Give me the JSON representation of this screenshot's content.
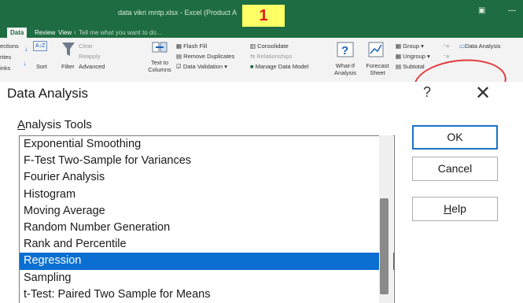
{
  "window": {
    "title": "data vikri mntp.xlsx - Excel (Product A",
    "annotation_badge": "1",
    "minimize_label": "—",
    "restore_label": "▣"
  },
  "tabs": [
    {
      "label": "Data",
      "active": true
    },
    {
      "label": "Review",
      "active": false
    },
    {
      "label": "View",
      "active": false
    }
  ],
  "tell_me": "♀ Tell me what you want to do...",
  "ribbon": {
    "left_partial": [
      "ections",
      "rties",
      "inks"
    ],
    "sort_az": "A↓Z",
    "sort_label": "Sort",
    "filter_label": "Filter",
    "clear_label": "Clear",
    "reapply_label": "Reapply",
    "advanced_label": "Advanced",
    "text_to_columns_label": "Text to Columns",
    "flash_fill_label": "Flash Fill",
    "remove_duplicates_label": "Remove Duplicates",
    "data_validation_label": "Data Validation",
    "consolidate_label": "Consolidate",
    "relationships_label": "Relationships",
    "manage_data_model_label": "Manage Data Model",
    "what_if_label": "What-If Analysis",
    "forecast_sheet_label": "Forecast Sheet",
    "group_label": "Group",
    "ungroup_label": "Ungroup",
    "subtotal_label": "Subtotal",
    "data_analysis_label": "Data Analysis",
    "accent_color": "#1e6c41",
    "highlight_color": "#e23b3b"
  },
  "dialog": {
    "title": "Data Analysis",
    "help_label": "?",
    "close_label": "✕",
    "tools_label_accel": "A",
    "tools_label_rest": "nalysis Tools",
    "tools": [
      "Exponential Smoothing",
      "F-Test Two-Sample for Variances",
      "Fourier Analysis",
      "Histogram",
      "Moving Average",
      "Random Number Generation",
      "Rank and Percentile",
      "Regression",
      "Sampling",
      "t-Test: Paired Two Sample for Means"
    ],
    "selected_tool": "Regression",
    "ok_label": "OK",
    "cancel_label": "Cancel",
    "help_btn_accel": "H",
    "help_btn_rest": "elp",
    "selection_color": "#0a6fd1"
  }
}
